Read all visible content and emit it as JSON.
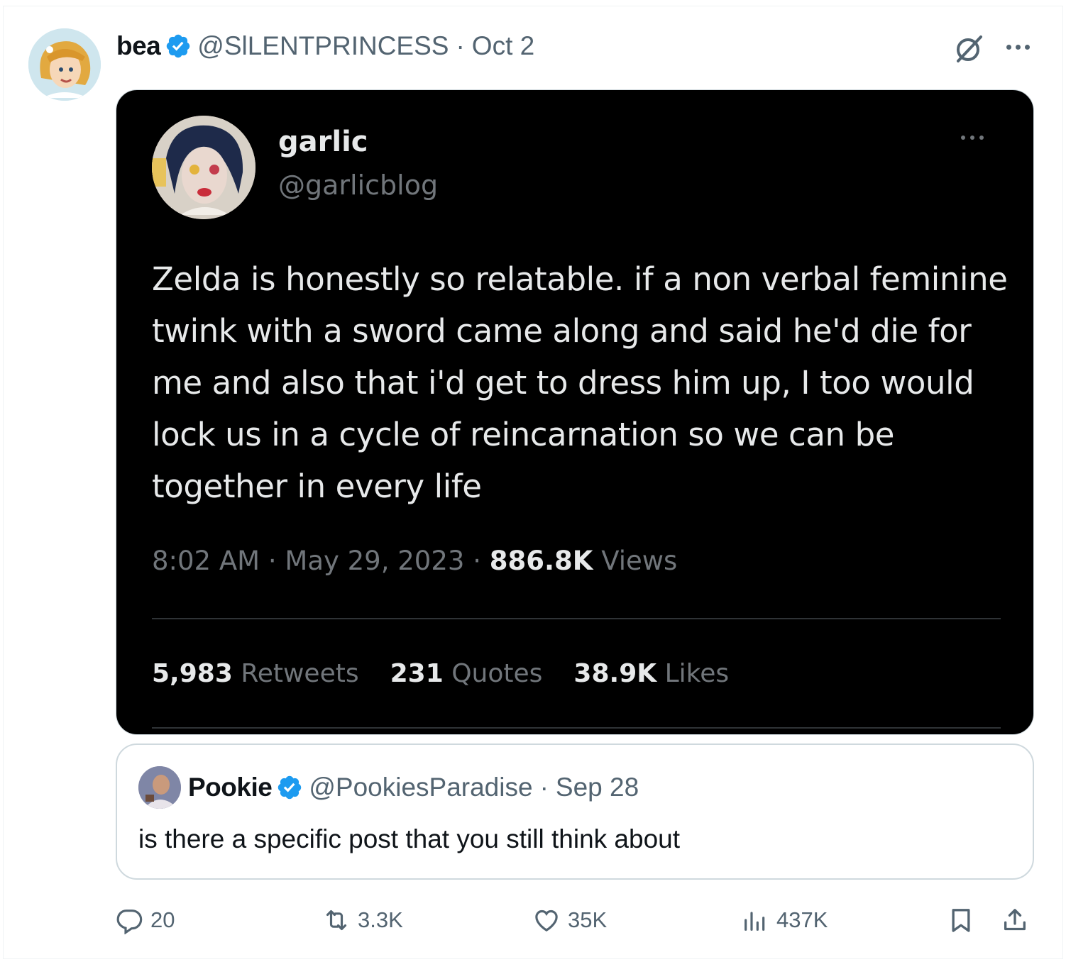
{
  "post": {
    "author_name": "bea",
    "author_handle": "@SlLENTPRINCESS",
    "separator": "·",
    "date": "Oct 2"
  },
  "embedded_screenshot": {
    "name": "garlic",
    "handle": "@garlicblog",
    "text": "Zelda is honestly so relatable. if a non verbal feminine twink with a sword came along and said he'd die for me and also that i'd get to dress him up, I too would lock us in a cycle of reincarnation so we can be together in every life",
    "time": "8:02 AM",
    "separator": "·",
    "date": "May 29, 2023",
    "views_count": "886.8K",
    "views_label": "Views",
    "retweets_count": "5,983",
    "retweets_label": "Retweets",
    "quotes_count": "231",
    "quotes_label": "Quotes",
    "likes_count": "38.9K",
    "likes_label": "Likes"
  },
  "quoted": {
    "author_name": "Pookie",
    "author_handle": "@PookiesParadise",
    "separator": "·",
    "date": "Sep 28",
    "text": "is there a specific post that you still think about"
  },
  "actions": {
    "replies": "20",
    "reposts": "3.3K",
    "likes": "35K",
    "views": "437K"
  },
  "colors": {
    "verified": "#1d9bf0",
    "muted": "#536471",
    "text": "#0f1419",
    "embed_bg": "#000000"
  },
  "icons": [
    "verified-badge-icon",
    "grok-icon",
    "more-icon",
    "reply-icon",
    "repost-icon",
    "like-icon",
    "views-icon",
    "bookmark-icon",
    "share-icon"
  ]
}
